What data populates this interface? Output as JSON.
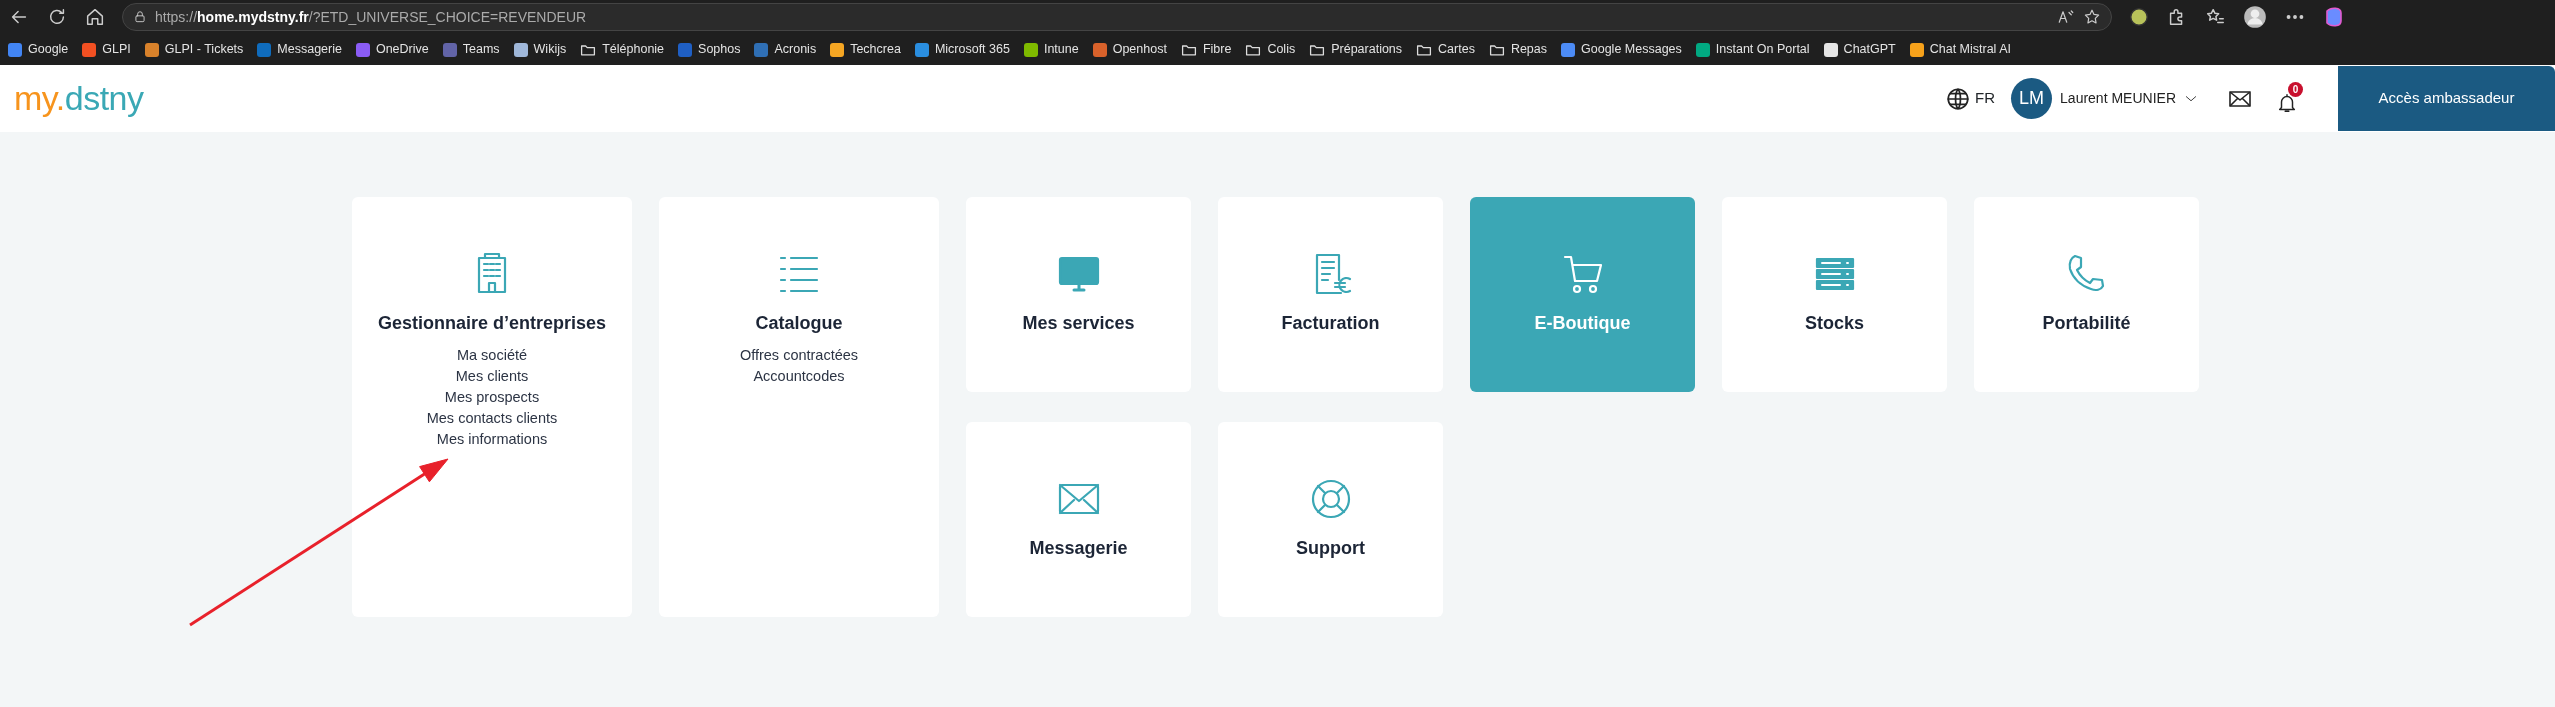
{
  "browser": {
    "url": "https://**home.mydstny.fr**/?ETD_UNIVERSE_CHOICE=REVENDEUR",
    "bookmarks": [
      {
        "label": "Google",
        "kind": "site",
        "color": "#4285f4"
      },
      {
        "label": "GLPI",
        "kind": "site",
        "color": "#f25022"
      },
      {
        "label": "GLPI - Tickets",
        "kind": "site",
        "color": "#d9822b"
      },
      {
        "label": "Messagerie",
        "kind": "site",
        "color": "#0f6cbd"
      },
      {
        "label": "OneDrive",
        "kind": "site",
        "color": "#8b5cf6"
      },
      {
        "label": "Teams",
        "kind": "site",
        "color": "#6264a7"
      },
      {
        "label": "Wikijs",
        "kind": "site",
        "color": "#9fb7d9"
      },
      {
        "label": "Téléphonie",
        "kind": "folder"
      },
      {
        "label": "Sophos",
        "kind": "site",
        "color": "#1f5fc4"
      },
      {
        "label": "Acronis",
        "kind": "site",
        "color": "#2f6fb5"
      },
      {
        "label": "Techcrea",
        "kind": "site",
        "color": "#f5a623"
      },
      {
        "label": "Microsoft 365",
        "kind": "site",
        "color": "#2a8ee0"
      },
      {
        "label": "Intune",
        "kind": "site",
        "color": "#7fba00"
      },
      {
        "label": "Openhost",
        "kind": "site",
        "color": "#d9622b"
      },
      {
        "label": "Fibre",
        "kind": "folder"
      },
      {
        "label": "Colis",
        "kind": "folder"
      },
      {
        "label": "Préparations",
        "kind": "folder"
      },
      {
        "label": "Cartes",
        "kind": "folder"
      },
      {
        "label": "Repas",
        "kind": "folder"
      },
      {
        "label": "Google Messages",
        "kind": "site",
        "color": "#4c8bf5"
      },
      {
        "label": "Instant On Portal",
        "kind": "site",
        "color": "#01a982"
      },
      {
        "label": "ChatGPT",
        "kind": "site",
        "color": "#e5e5e5"
      },
      {
        "label": "Chat Mistral AI",
        "kind": "site",
        "color": "#f7a21b"
      }
    ]
  },
  "header": {
    "logo": {
      "prefix": "my.",
      "name": "dstny"
    },
    "language": "FR",
    "user": {
      "initials": "LM",
      "name": "Laurent MEUNIER"
    },
    "notifications": "0",
    "ambassador_button": "Accès ambassadeur"
  },
  "tiles": [
    {
      "title": "Gestionnaire d’entreprises",
      "links": [
        "Ma société",
        "Mes clients",
        "Mes prospects",
        "Mes contacts clients",
        "Mes informations"
      ],
      "selected": false
    },
    {
      "title": "Catalogue",
      "links": [
        "Offres contractées",
        "Accountcodes"
      ],
      "selected": false
    },
    {
      "title": "Mes services",
      "selected": false
    },
    {
      "title": "Facturation",
      "selected": false
    },
    {
      "title": "E-Boutique",
      "selected": true
    },
    {
      "title": "Stocks",
      "selected": false
    },
    {
      "title": "Portabilité",
      "selected": false
    },
    {
      "title": "Messagerie",
      "selected": false
    },
    {
      "title": "Support",
      "selected": false
    }
  ]
}
